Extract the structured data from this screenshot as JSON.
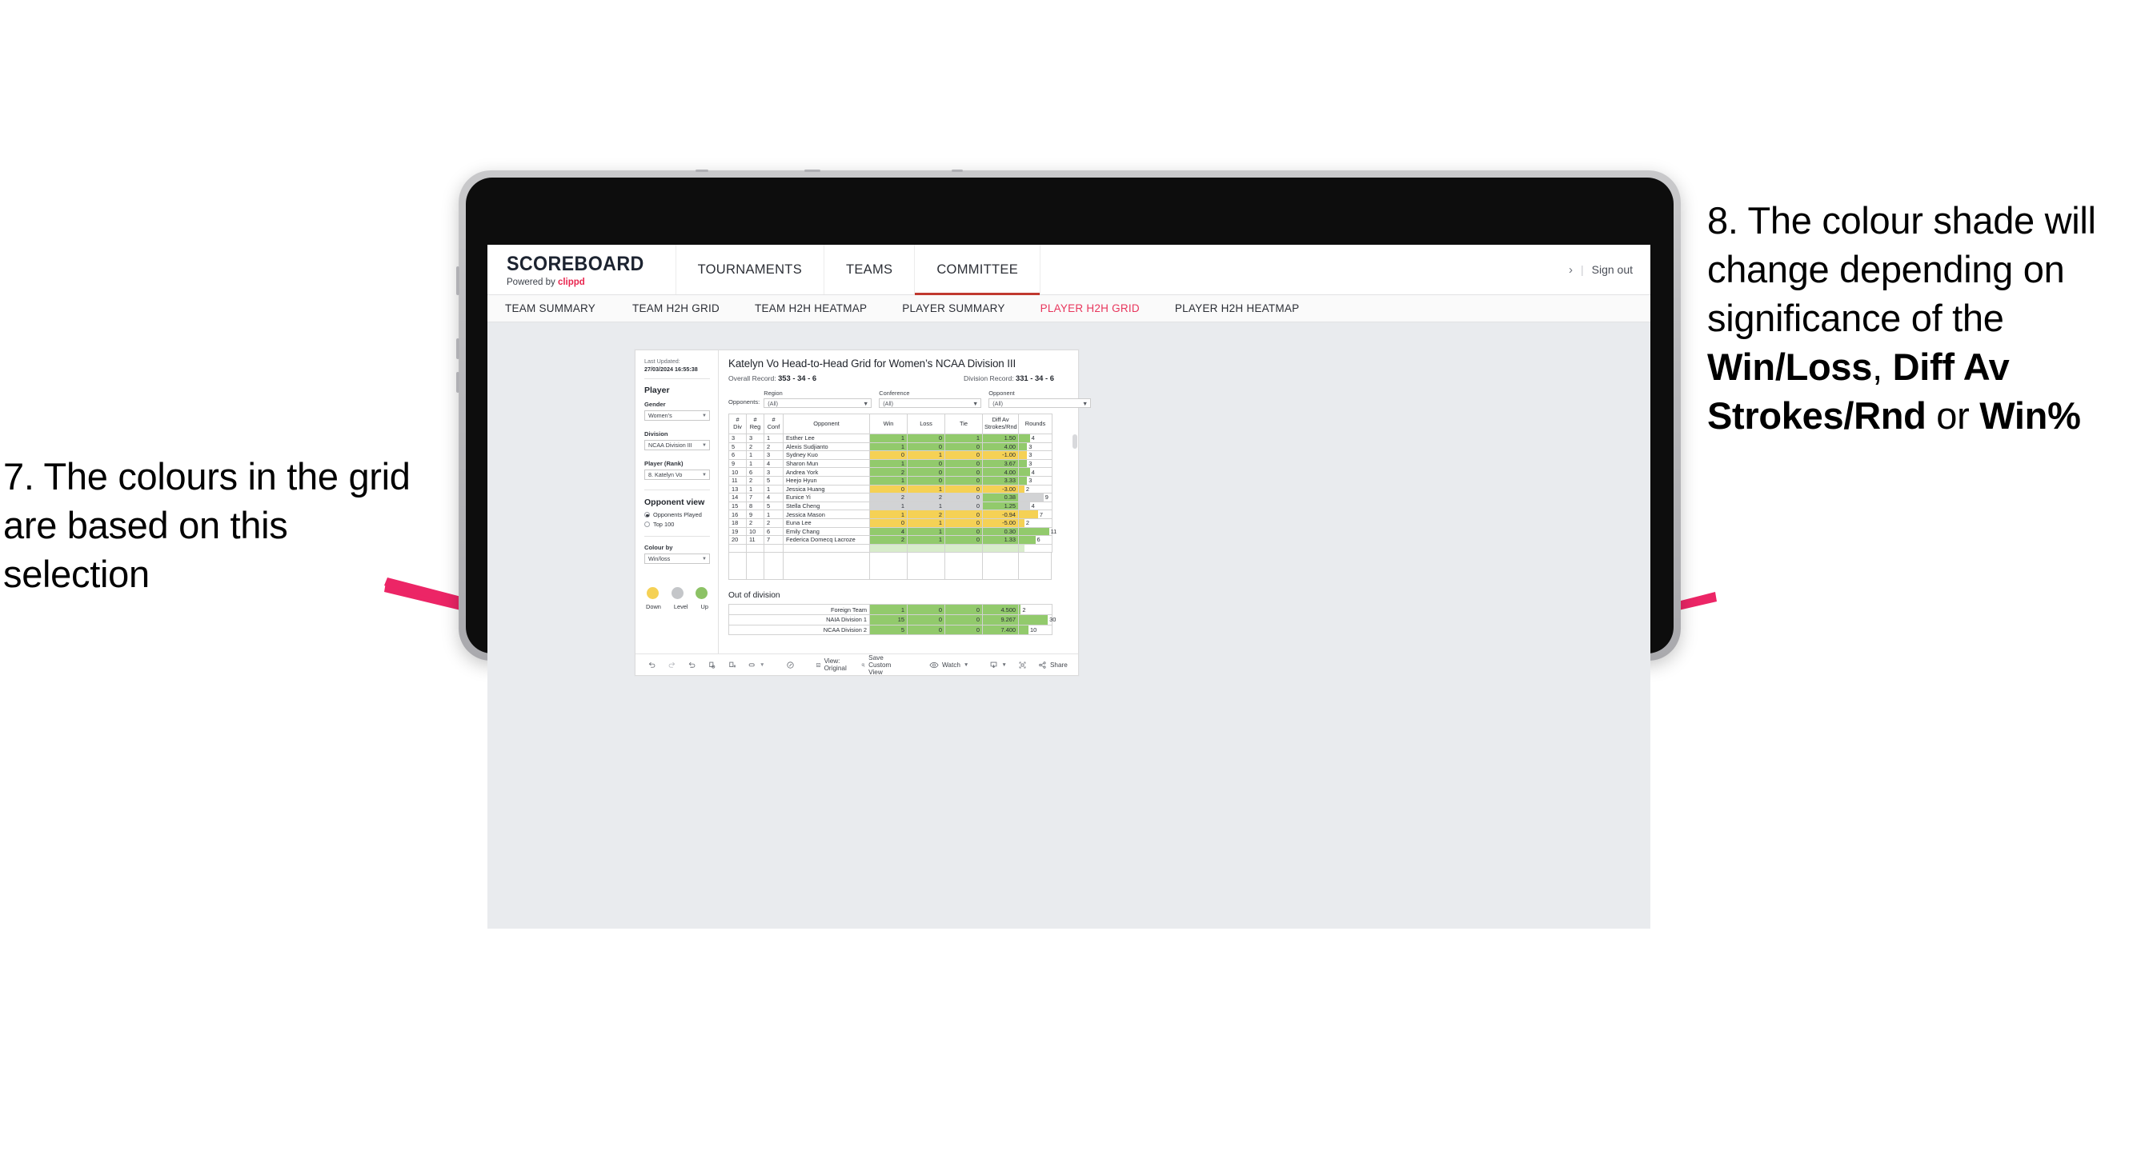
{
  "annotations": {
    "left": "7. The colours in the grid are based on this selection",
    "right_pre": "8. The colour shade will change depending on significance of the ",
    "right_b1": "Win/Loss",
    "right_mid1": ", ",
    "right_b2": "Diff Av Strokes/Rnd",
    "right_mid2": " or ",
    "right_b3": "Win%",
    "arrow_color": "#ec2566"
  },
  "app": {
    "brand": {
      "title": "SCOREBOARD",
      "powered_prefix": "Powered by ",
      "powered_by": "clippd"
    },
    "main_nav": [
      {
        "label": "TOURNAMENTS",
        "active": false
      },
      {
        "label": "TEAMS",
        "active": false
      },
      {
        "label": "COMMITTEE",
        "active": true
      }
    ],
    "top_right": {
      "chevron": "›",
      "separator": "|",
      "sign_out": "Sign out"
    },
    "sub_nav": [
      {
        "label": "TEAM SUMMARY",
        "active": false
      },
      {
        "label": "TEAM H2H GRID",
        "active": false
      },
      {
        "label": "TEAM H2H HEATMAP",
        "active": false
      },
      {
        "label": "PLAYER SUMMARY",
        "active": false
      },
      {
        "label": "PLAYER H2H GRID",
        "active": true
      },
      {
        "label": "PLAYER H2H HEATMAP",
        "active": false
      }
    ]
  },
  "filters": {
    "last_updated_label": "Last Updated: ",
    "last_updated_value": "27/03/2024 16:55:38",
    "player_heading": "Player",
    "gender_label": "Gender",
    "gender_value": "Women’s",
    "division_label": "Division",
    "division_value": "NCAA Division III",
    "player_rank_label": "Player (Rank)",
    "player_rank_value": "8. Katelyn Vo",
    "opponent_view_heading": "Opponent view",
    "opponent_view_options": [
      {
        "label": "Opponents Played",
        "selected": true
      },
      {
        "label": "Top 100",
        "selected": false
      }
    ],
    "colour_by_label": "Colour by",
    "colour_by_value": "Win/loss",
    "legend": [
      {
        "label": "Down",
        "color": "#f5d155"
      },
      {
        "label": "Level",
        "color": "#c4c6c9"
      },
      {
        "label": "Up",
        "color": "#8cc265"
      }
    ]
  },
  "view": {
    "title": "Katelyn Vo Head-to-Head Grid for Women’s NCAA Division III",
    "overall_record_label": "Overall Record: ",
    "overall_record_value": "353 -  34 - 6",
    "division_record_label": "Division Record: ",
    "division_record_value": "331 -  34 - 6",
    "opponents_label": "Opponents:",
    "opponent_filters": [
      {
        "label": "Region",
        "value": "(All)"
      },
      {
        "label": "Conference",
        "value": "(All)"
      },
      {
        "label": "Opponent",
        "value": "(All)"
      }
    ]
  },
  "grid": {
    "headers": [
      "# Div",
      "# Reg",
      "# Conf",
      "Opponent",
      "Win",
      "Loss",
      "Tie",
      "Diff Av Strokes/Rnd",
      "Rounds"
    ],
    "header_lines": [
      [
        "#",
        "Div"
      ],
      [
        "#",
        "Reg"
      ],
      [
        "#",
        "Conf"
      ],
      [
        "Opponent"
      ],
      [
        "Win"
      ],
      [
        "Loss"
      ],
      [
        "Tie"
      ],
      [
        "Diff Av",
        "Strokes/Rnd"
      ],
      [
        "Rounds"
      ]
    ],
    "rounds_max": 12,
    "rows": [
      {
        "div": "3",
        "reg": "3",
        "conf": "1",
        "opponent": "Esther Lee",
        "win": "1",
        "loss": "0",
        "tie": "1",
        "diff": "1.50",
        "rounds": "4",
        "shade": "green"
      },
      {
        "div": "5",
        "reg": "2",
        "conf": "2",
        "opponent": "Alexis Sudjianto",
        "win": "1",
        "loss": "0",
        "tie": "0",
        "diff": "4.00",
        "rounds": "3",
        "shade": "green"
      },
      {
        "div": "6",
        "reg": "1",
        "conf": "3",
        "opponent": "Sydney Kuo",
        "win": "0",
        "loss": "1",
        "tie": "0",
        "diff": "-1.00",
        "rounds": "3",
        "shade": "yellow"
      },
      {
        "div": "9",
        "reg": "1",
        "conf": "4",
        "opponent": "Sharon Mun",
        "win": "1",
        "loss": "0",
        "tie": "0",
        "diff": "3.67",
        "rounds": "3",
        "shade": "green"
      },
      {
        "div": "10",
        "reg": "6",
        "conf": "3",
        "opponent": "Andrea York",
        "win": "2",
        "loss": "0",
        "tie": "0",
        "diff": "4.00",
        "rounds": "4",
        "shade": "green"
      },
      {
        "div": "11",
        "reg": "2",
        "conf": "5",
        "opponent": "Heejo Hyun",
        "win": "1",
        "loss": "0",
        "tie": "0",
        "diff": "3.33",
        "rounds": "3",
        "shade": "green"
      },
      {
        "div": "13",
        "reg": "1",
        "conf": "1",
        "opponent": "Jessica Huang",
        "win": "0",
        "loss": "1",
        "tie": "0",
        "diff": "-3.00",
        "rounds": "2",
        "shade": "yellow"
      },
      {
        "div": "14",
        "reg": "7",
        "conf": "4",
        "opponent": "Eunice Yi",
        "win": "2",
        "loss": "2",
        "tie": "0",
        "diff": "0.38",
        "rounds": "9",
        "shade": "grey",
        "diff_shade": "green"
      },
      {
        "div": "15",
        "reg": "8",
        "conf": "5",
        "opponent": "Stella Cheng",
        "win": "1",
        "loss": "1",
        "tie": "0",
        "diff": "1.25",
        "rounds": "4",
        "shade": "grey",
        "diff_shade": "green"
      },
      {
        "div": "16",
        "reg": "9",
        "conf": "1",
        "opponent": "Jessica Mason",
        "win": "1",
        "loss": "2",
        "tie": "0",
        "diff": "-0.94",
        "rounds": "7",
        "shade": "yellow"
      },
      {
        "div": "18",
        "reg": "2",
        "conf": "2",
        "opponent": "Euna Lee",
        "win": "0",
        "loss": "1",
        "tie": "0",
        "diff": "-5.00",
        "rounds": "2",
        "shade": "yellow"
      },
      {
        "div": "19",
        "reg": "10",
        "conf": "6",
        "opponent": "Emily Chang",
        "win": "4",
        "loss": "1",
        "tie": "0",
        "diff": "0.30",
        "rounds": "11",
        "shade": "green"
      },
      {
        "div": "20",
        "reg": "11",
        "conf": "7",
        "opponent": "Federica Domecq Lacroze",
        "win": "2",
        "loss": "1",
        "tie": "0",
        "diff": "1.33",
        "rounds": "6",
        "shade": "green"
      }
    ]
  },
  "out_of_division": {
    "title": "Out of division",
    "rounds_max": 34,
    "rows": [
      {
        "name": "Foreign Team",
        "win": "1",
        "loss": "0",
        "tie": "0",
        "diff": "4.500",
        "rounds": "2",
        "shade": "green"
      },
      {
        "name": "NAIA Division 1",
        "win": "15",
        "loss": "0",
        "tie": "0",
        "diff": "9.267",
        "rounds": "30",
        "shade": "green"
      },
      {
        "name": "NCAA Division 2",
        "win": "5",
        "loss": "0",
        "tie": "0",
        "diff": "7.400",
        "rounds": "10",
        "shade": "green"
      }
    ]
  },
  "toolbar": {
    "undo": "undo-icon",
    "redo": "redo-icon",
    "revert": "revert-icon",
    "refresh": "refresh-data-icon",
    "pause": "pause-auto-update-icon",
    "highlight": "highlight-icon",
    "alert": "alert-icon",
    "view_label": "View: Original",
    "save_custom_view": "Save Custom View",
    "watch": "Watch",
    "download": "download-icon",
    "fullscreen": "fullscreen-icon",
    "share": "Share"
  }
}
